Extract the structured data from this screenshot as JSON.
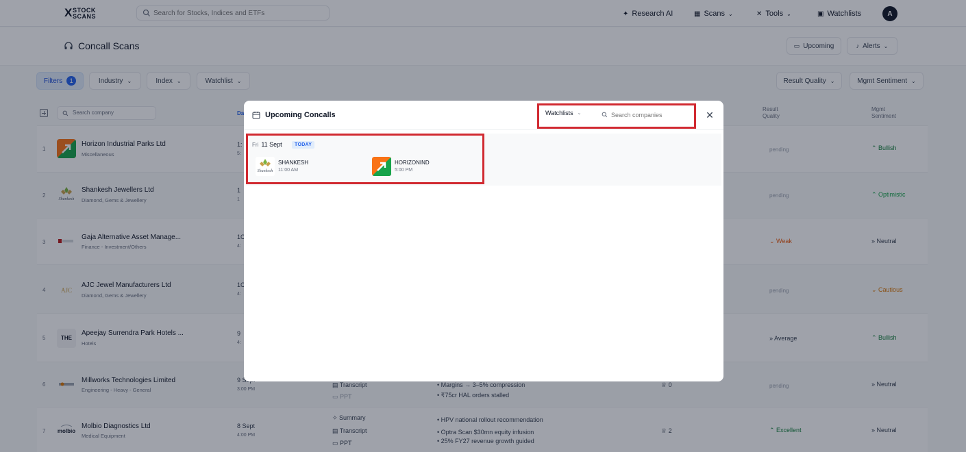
{
  "brand": {
    "logo_mark": "X",
    "logo_line1": "STOCK",
    "logo_line2": "SCANS"
  },
  "search": {
    "placeholder": "Search for Stocks, Indices and ETFs"
  },
  "nav": {
    "research_ai": "Research AI",
    "scans": "Scans",
    "tools": "Tools",
    "watchlists": "Watchlists",
    "avatar_initial": "A"
  },
  "header": {
    "title": "Concall Scans",
    "upcoming_label": "Upcoming",
    "alerts_label": "Alerts"
  },
  "filters": {
    "filters_label": "Filters",
    "filters_count": "1",
    "industry": "Industry",
    "index": "Index",
    "watchlist": "Watchlist",
    "result_quality": "Result Quality",
    "mgmt_sentiment": "Mgmt Sentiment"
  },
  "table": {
    "search_placeholder": "Search company",
    "col_date_partial": "Da",
    "col_result_quality_1": "Result",
    "col_result_quality_2": "Quality",
    "col_mgmt_1": "Mgmt",
    "col_mgmt_2": "Sentiment",
    "rows": [
      {
        "num": "1",
        "name": "Horizon Industrial Parks Ltd",
        "sector": "Miscellaneous",
        "date": "1:",
        "time": "5:",
        "quality": "pending",
        "sentiment": "Bullish",
        "sentiment_color": "#15803d"
      },
      {
        "num": "2",
        "name": "Shankesh Jewellers Ltd",
        "sector": "Diamond, Gems & Jewellery",
        "date": "1",
        "time": "1",
        "quality": "pending",
        "sentiment": "Optimistic",
        "sentiment_color": "#16a34a"
      },
      {
        "num": "3",
        "name": "Gaja Alternative Asset Manage...",
        "sector": "Finance - Investment/Others",
        "date": "1C",
        "time": "4:",
        "quality": "Weak",
        "quality_color": "#ea580c",
        "sentiment": "Neutral",
        "sentiment_color": "#374151"
      },
      {
        "num": "4",
        "name": "AJC Jewel Manufacturers Ltd",
        "sector": "Diamond, Gems & Jewellery",
        "date": "1C",
        "time": "4:",
        "quality": "pending",
        "sentiment": "Cautious",
        "sentiment_color": "#d97706"
      },
      {
        "num": "5",
        "name": "Apeejay Surrendra Park Hotels ...",
        "sector": "Hotels",
        "date": "9",
        "time": "4:",
        "quality": "Average",
        "quality_color": "#374151",
        "sentiment": "Bullish",
        "sentiment_color": "#15803d"
      },
      {
        "num": "6",
        "name": "Millworks Technologies Limited",
        "sector": "Engineering - Heavy - General",
        "date": "9 Sept",
        "time": "3:00 PM",
        "quality": "pending",
        "sentiment": "Neutral",
        "sentiment_color": "#374151",
        "doc1": "Transcript",
        "doc2": "PPT",
        "bullet1": "Margins → 3–5% compression",
        "bullet2": "₹75cr HAL orders stalled",
        "trophy": "0"
      },
      {
        "num": "7",
        "name": "Molbio Diagnostics Ltd",
        "sector": "Medical Equipment",
        "date": "8 Sept",
        "time": "4:00 PM",
        "quality": "Excellent",
        "quality_color": "#15803d",
        "sentiment": "Neutral",
        "sentiment_color": "#374151",
        "doc0": "Summary",
        "doc1": "Transcript",
        "doc2": "PPT",
        "bullet0": "HPV national rollout recommendation",
        "bullet1": "Optra Scan $30mn equity infusion",
        "bullet2": "25% FY27 revenue growth guided",
        "trophy": "2"
      }
    ]
  },
  "modal": {
    "title": "Upcoming Concalls",
    "watchlists_label": "Watchlists",
    "search_placeholder": "Search companies",
    "day": {
      "dow": "Fri",
      "date": "11 Sept",
      "tag": "TODAY"
    },
    "concalls": [
      {
        "symbol": "SHANKESH",
        "time": "11:00 AM"
      },
      {
        "symbol": "HORIZONIND",
        "time": "5:00 PM"
      }
    ],
    "highlight_color": "#d12a31"
  }
}
